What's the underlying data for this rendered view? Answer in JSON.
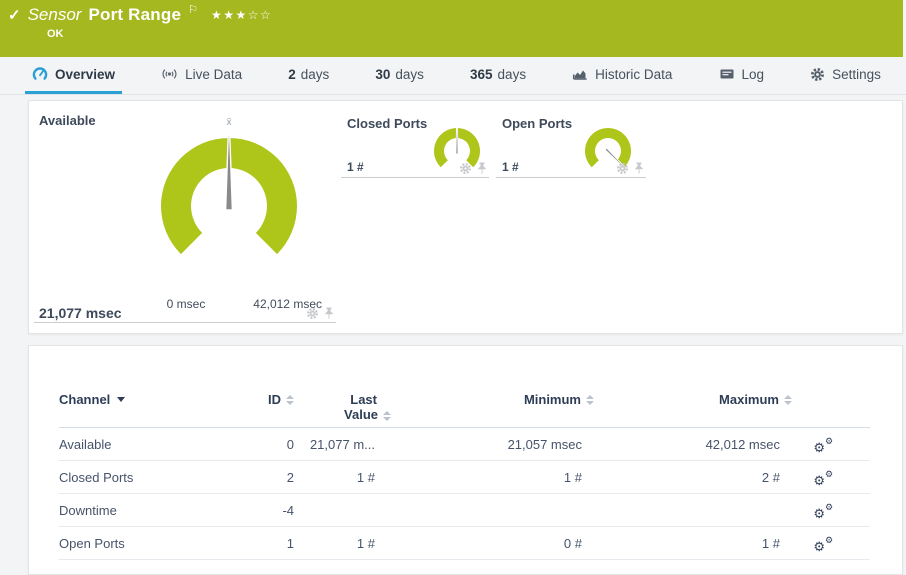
{
  "colors": {
    "brand_green": "#a6b81f",
    "gauge_green": "#aec51a",
    "accent_blue": "#2aa0d5"
  },
  "header": {
    "type_label": "Sensor",
    "title": "Port Range",
    "status": "OK",
    "stars": "★★★☆☆",
    "check_icon": "check-icon",
    "flag_icon": "flag-icon"
  },
  "tabs": {
    "overview": {
      "label": "Overview",
      "icon": "gauge-icon"
    },
    "live_data": {
      "label": "Live Data",
      "icon": "broadcast-icon"
    },
    "days2": {
      "num": "2",
      "label": "days"
    },
    "days30": {
      "num": "30",
      "label": "days"
    },
    "days365": {
      "num": "365",
      "label": "days"
    },
    "historic": {
      "label": "Historic Data",
      "icon": "area-chart-icon"
    },
    "log": {
      "label": "Log",
      "icon": "log-list-icon"
    },
    "settings": {
      "label": "Settings",
      "icon": "gear-icon"
    }
  },
  "gauges": {
    "available": {
      "title": "Available",
      "value": "21,077 msec",
      "min_label": "0 msec",
      "max_label": "42,012 msec",
      "mean_marker": "x̄"
    },
    "closed_ports": {
      "title": "Closed Ports",
      "value": "1 #"
    },
    "open_ports": {
      "title": "Open Ports",
      "value": "1 #"
    }
  },
  "table": {
    "headers": {
      "channel": "Channel",
      "id": "ID",
      "last_value_line1": "Last",
      "last_value_line2": "Value",
      "minimum": "Minimum",
      "maximum": "Maximum"
    },
    "rows": [
      {
        "channel": "Available",
        "id": "0",
        "last": "21,077 m...",
        "min": "21,057 msec",
        "max": "42,012 msec"
      },
      {
        "channel": "Closed Ports",
        "id": "2",
        "last": "1 #",
        "min": "1 #",
        "max": "2 #"
      },
      {
        "channel": "Downtime",
        "id": "-4",
        "last": "",
        "min": "",
        "max": ""
      },
      {
        "channel": "Open Ports",
        "id": "1",
        "last": "1 #",
        "min": "0 #",
        "max": "1 #"
      }
    ]
  }
}
